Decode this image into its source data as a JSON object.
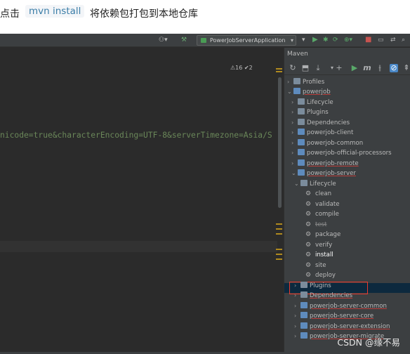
{
  "caption": {
    "prefix": "点击",
    "code": "mvn install",
    "suffix": "将依赖包打包到本地仓库"
  },
  "toolbar": {
    "run_config": "PowerJobServerApplication"
  },
  "editor": {
    "warnings": "⚠16 ✔2",
    "code_text": "nicode=true&characterEncoding=UTF-8&serverTimezone=Asia/S"
  },
  "maven": {
    "title": "Maven",
    "tree": [
      {
        "label": "Profiles"
      },
      {
        "label": "powerjob"
      },
      {
        "label": "Lifecycle"
      },
      {
        "label": "Plugins"
      },
      {
        "label": "Dependencies"
      },
      {
        "label": "powerjob-client"
      },
      {
        "label": "powerjob-common"
      },
      {
        "label": "powerjob-official-processors"
      },
      {
        "label": "powerjob-remote"
      },
      {
        "label": "powerjob-server"
      },
      {
        "label": "Lifecycle"
      },
      {
        "label": "clean"
      },
      {
        "label": "validate"
      },
      {
        "label": "compile"
      },
      {
        "label": "test"
      },
      {
        "label": "package"
      },
      {
        "label": "verify"
      },
      {
        "label": "install"
      },
      {
        "label": "site"
      },
      {
        "label": "deploy"
      },
      {
        "label": "Plugins"
      },
      {
        "label": "Dependencies"
      },
      {
        "label": "powerjob-server-common"
      },
      {
        "label": "powerjob-server-core"
      },
      {
        "label": "powerjob-server-extension"
      },
      {
        "label": "powerjob-server-migrate"
      }
    ]
  },
  "watermark": "CSDN @缘不易",
  "colors": {
    "ide_bg": "#2b2b2b",
    "panel_bg": "#3c3f41",
    "string_green": "#6a8759",
    "highlight_box": "#e8392f",
    "selection": "#0d293e"
  }
}
